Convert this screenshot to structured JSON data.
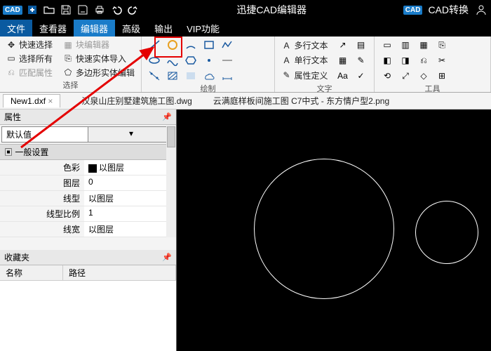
{
  "app": {
    "title": "迅捷CAD编辑器",
    "convert_label": "CAD转换"
  },
  "menu": {
    "items": [
      "文件",
      "查看器",
      "编辑器",
      "高级",
      "输出",
      "VIP功能"
    ],
    "active_index": 2
  },
  "ribbon": {
    "group0": {
      "kuaisu_xuanze": "快速选择",
      "xuanze_suoyou": "选择所有",
      "pipei_shuxing": "匹配属性",
      "kuai_bianji": "块编辑器",
      "kuaisu_shiti": "快速实体导入",
      "duobian_shiti": "多边形实体编辑",
      "label": "选择"
    },
    "group1_label": "绘制",
    "group2": {
      "duohang": "多行文本",
      "danhang": "单行文本",
      "shuxing": "属性定义",
      "label": "文字"
    },
    "group3_label": "工具"
  },
  "tabs": {
    "active": "New1.dxf",
    "file1": "汉泉山庄别墅建筑施工图.dwg",
    "file2": "云满庭样板间施工图 C7中式 - 东方情户型2.png"
  },
  "props": {
    "panel_title": "属性",
    "default_label": "默认值",
    "section1": "一般设置",
    "rows": [
      {
        "k": "色彩",
        "v": "以图层",
        "swatch": true
      },
      {
        "k": "图层",
        "v": "0"
      },
      {
        "k": "线型",
        "v": "以图层"
      },
      {
        "k": "线型比例",
        "v": "1"
      },
      {
        "k": "线宽",
        "v": "以图层"
      }
    ],
    "fav_title": "收藏夹",
    "fav_cols": [
      "名称",
      "路径"
    ]
  }
}
